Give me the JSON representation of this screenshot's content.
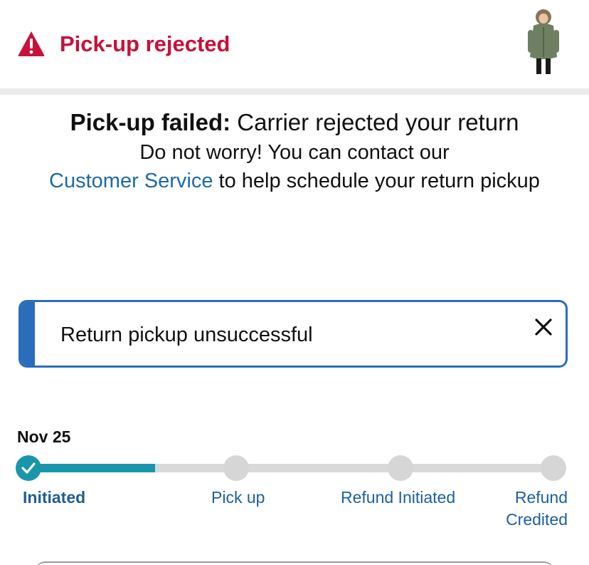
{
  "header": {
    "title": "Pick-up rejected"
  },
  "message": {
    "headline_bold": "Pick-up failed:",
    "headline_rest": " Carrier rejected your return",
    "line1": "Do not worry! You can contact our",
    "link_text": "Customer Service",
    "line2_rest": " to help schedule your return pickup"
  },
  "alert": {
    "text": "Return pickup unsuccessful"
  },
  "tracker": {
    "date": "Nov 25",
    "progress": 0.19,
    "steps": [
      {
        "label": "Initiated",
        "status": "completed"
      },
      {
        "label": "Pick up",
        "status": "pending"
      },
      {
        "label": "Refund Initiated",
        "status": "pending"
      },
      {
        "label": "Refund Credited",
        "status": "pending"
      }
    ]
  },
  "colors": {
    "alert_red": "#c7113a",
    "link_blue": "#1d6aa8",
    "progress_teal": "#1a96aa",
    "info_blue": "#2a6ebb"
  }
}
